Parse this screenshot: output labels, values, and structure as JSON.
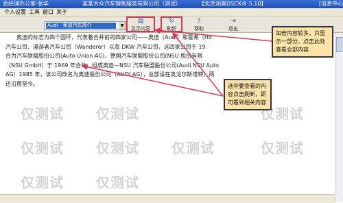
{
  "titlebar": {
    "app": "总经理办公室-张华",
    "company": "某某大众汽车销售服务有限公司（测试）",
    "server": "【北京润普DSCK®  5.10】",
    "info": "[信息中心]"
  },
  "menu": [
    "个人设置",
    "工具",
    "窗口",
    "关于"
  ],
  "toolbar": {
    "combo_value": "Audi - 奥迪汽车简介",
    "combo_arrow": "▼",
    "buttons": [
      {
        "label": "显示内容",
        "icon": "document-icon",
        "glyph": "▤"
      },
      {
        "label": "刷新",
        "icon": "refresh-icon",
        "glyph": "↻"
      },
      {
        "label": "帮助",
        "icon": "help-icon",
        "glyph": "?"
      },
      {
        "label": "退出",
        "icon": "exit-icon",
        "glyph": "⇥"
      }
    ]
  },
  "document": {
    "lines": [
      "　　奥迪的标志为四个圆环，代表着合并前的四家公司——奥迪（Audi）和霍希（Ho",
      "汽车公司、漫游者汽车公司（Wanderer）以及 DKW 汽车公司，这四家公司于 19",
      "合为汽车联盟股份公司(Auto Union AG)，德国汽车联盟股份公司(NSU 股份有限",
      "（NSU GmbH）于 1969 年合并，组成奥迪—NSU 汽车联盟股份公司(Audi NSU Auto",
      "AG）1985 年，该公司改名为奥迪股份公司（AUDI AG），总部设在英戈尔斯塔特，两",
      "还沿用至今。"
    ]
  },
  "callouts": {
    "top": "如若内容较多，只显示一部分，点击此处查看全部内容",
    "middle": "选中要查看的内容点击刷新，即可看到相关内容"
  },
  "watermark": "仅测试",
  "colors": {
    "titlebar": "#1d4fb8",
    "highlight": "#d43a55",
    "callout": "#fde3a7",
    "arrow": "#d43a55"
  }
}
